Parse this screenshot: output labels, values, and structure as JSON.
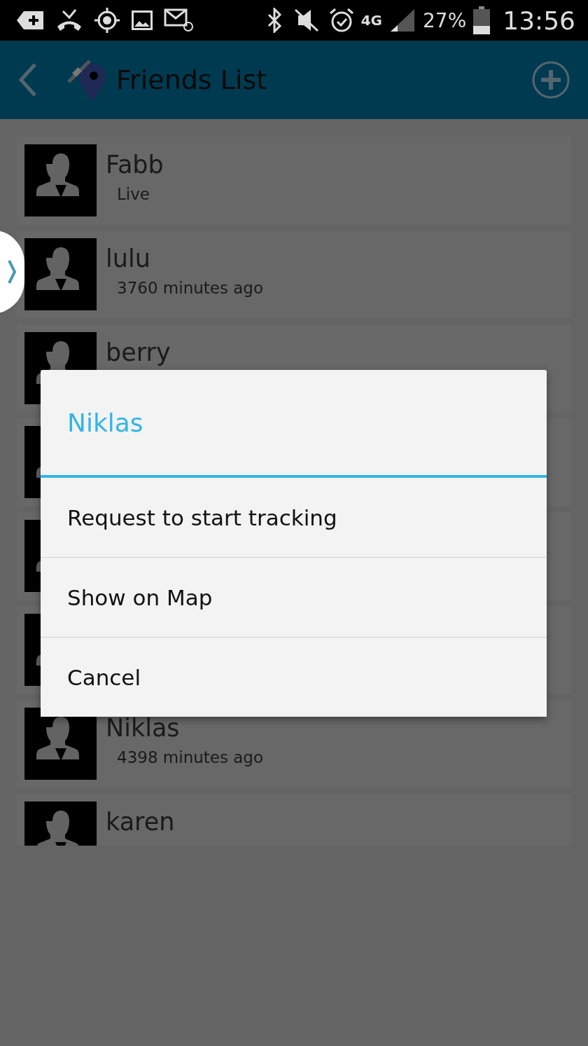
{
  "status_bar": {
    "network": "4G",
    "battery": "27%",
    "time": "13:56"
  },
  "app_bar": {
    "title": "Friends List"
  },
  "friends": [
    {
      "kind": "named",
      "name": "Fabb",
      "status": "Live"
    },
    {
      "kind": "named",
      "name": "lulu",
      "status": "3760 minutes ago"
    },
    {
      "kind": "named",
      "name": "berry"
    },
    {
      "kind": "covered"
    },
    {
      "kind": "covered"
    },
    {
      "kind": "covered"
    },
    {
      "kind": "named",
      "name": "Niklas",
      "status": "4398 minutes ago"
    },
    {
      "kind": "named",
      "name": "karen"
    }
  ],
  "dialog": {
    "title": "Niklas",
    "options": [
      "Request to start tracking",
      "Show on Map",
      "Cancel"
    ]
  }
}
